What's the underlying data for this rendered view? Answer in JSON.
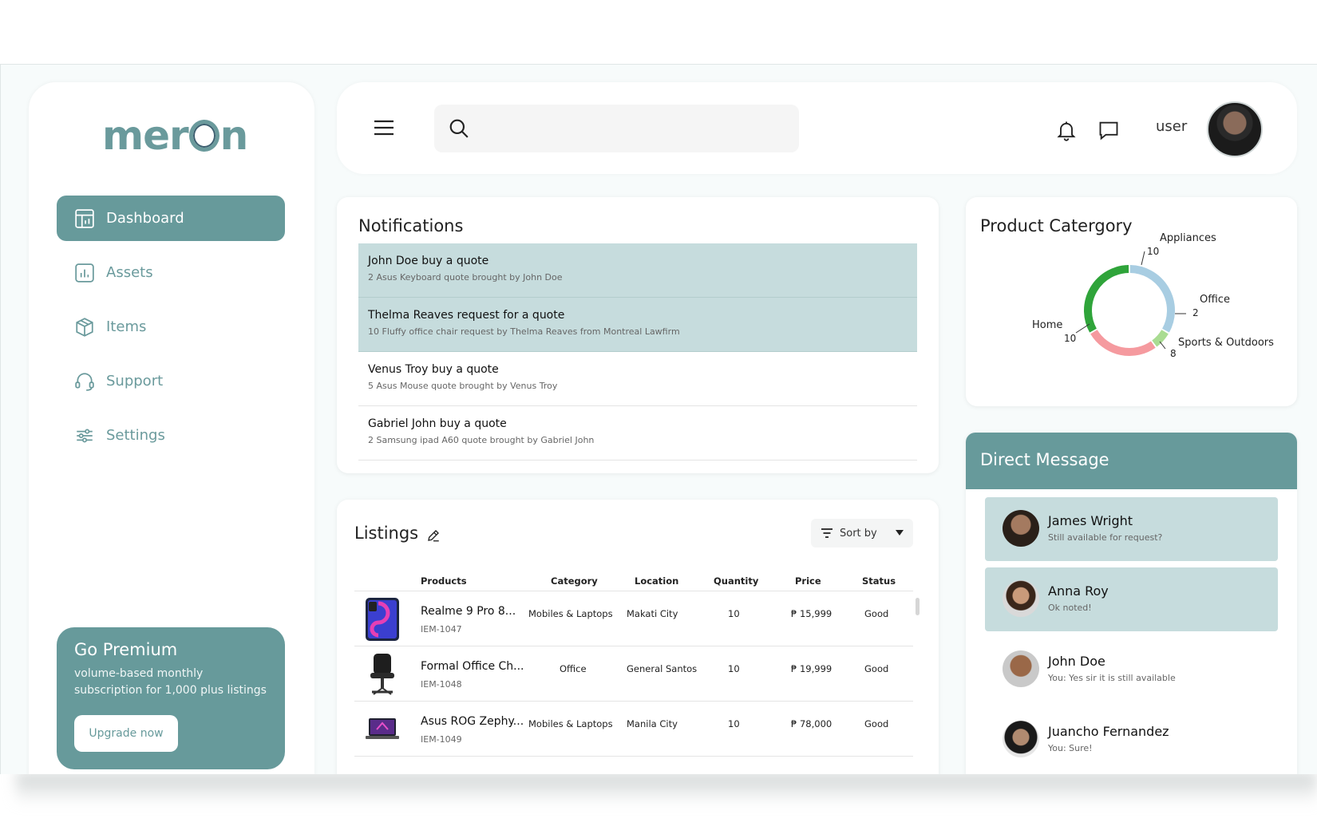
{
  "sidebar": {
    "logo": "merOn",
    "items": [
      {
        "label": "Dashboard",
        "icon": "dashboard-icon"
      },
      {
        "label": "Assets",
        "icon": "chart-icon"
      },
      {
        "label": "Items",
        "icon": "box-icon"
      },
      {
        "label": "Support",
        "icon": "headset-icon"
      },
      {
        "label": "Settings",
        "icon": "sliders-icon"
      }
    ],
    "premium": {
      "title": "Go Premium",
      "text": "volume-based monthly subscription for 1,000 plus listings",
      "button": "Upgrade now"
    }
  },
  "header": {
    "search_placeholder": "",
    "user_label": "user"
  },
  "notifications": {
    "title": "Notifications",
    "items": [
      {
        "title": "John Doe buy a quote",
        "sub": "2 Asus Keyboard quote brought by John Doe",
        "highlight": true
      },
      {
        "title": "Thelma Reaves request for a quote",
        "sub": "10 Fluffy office chair request by Thelma Reaves from Montreal Lawfirm",
        "highlight": true
      },
      {
        "title": "Venus Troy buy a quote",
        "sub": "5 Asus Mouse quote brought by Venus Troy",
        "highlight": false
      },
      {
        "title": "Gabriel John buy a quote",
        "sub": "2 Samsung ipad A60 quote brought by Gabriel John",
        "highlight": false
      }
    ]
  },
  "listings": {
    "title": "Listings",
    "sort_label": "Sort by",
    "columns": [
      "Products",
      "Category",
      "Location",
      "Quantity",
      "Price",
      "Status"
    ],
    "rows": [
      {
        "name": "Realme 9 Pro 8...",
        "id": "IEM-1047",
        "category": "Mobiles & Laptops",
        "location": "Makati City",
        "quantity": "10",
        "price": "₱ 15,999",
        "status": "Good"
      },
      {
        "name": "Formal Office Ch...",
        "id": "IEM-1048",
        "category": "Office",
        "location": "General Santos",
        "quantity": "10",
        "price": "₱ 19,999",
        "status": "Good"
      },
      {
        "name": "Asus ROG Zephy...",
        "id": "IEM-1049",
        "category": "Mobiles & Laptops",
        "location": "Manila City",
        "quantity": "10",
        "price": "₱ 78,000",
        "status": "Good"
      }
    ]
  },
  "category": {
    "title": "Product Catergory",
    "chart_data": {
      "type": "pie",
      "categories": [
        "Appliances",
        "Office",
        "Sports & Outdoors",
        "Home"
      ],
      "values": [
        10,
        2,
        8,
        10
      ],
      "colors": [
        "#a8cde2",
        "#a9dc92",
        "#f59a9f",
        "#2fa43a"
      ]
    }
  },
  "dm": {
    "title": "Direct Message",
    "items": [
      {
        "name": "James Wright",
        "msg": "Still available for request?",
        "highlight": true
      },
      {
        "name": "Anna Roy",
        "msg": "Ok noted!",
        "highlight": true
      },
      {
        "name": "John Doe",
        "msg": "You: Yes sir it is still available",
        "highlight": false
      },
      {
        "name": "Juancho Fernandez",
        "msg": "You: Sure!",
        "highlight": false
      }
    ]
  }
}
